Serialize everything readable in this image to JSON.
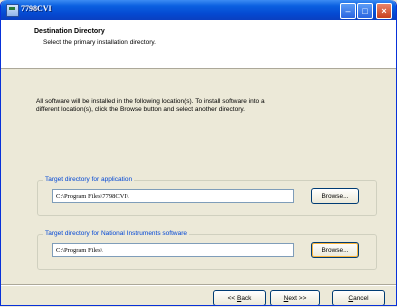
{
  "window": {
    "title": "7798CVI"
  },
  "header": {
    "title": "Destination Directory",
    "subtitle": "Select the primary installation directory."
  },
  "intro": {
    "line1": "All software will be installed in the following location(s). To install software into a",
    "line2": "different location(s), click the Browse button and select another directory."
  },
  "groups": {
    "app": {
      "label": "Target directory for application",
      "path": "C:\\Program Files\\7798CVI\\",
      "browse_label": "Browse..."
    },
    "ni": {
      "label": "Target directory for National Instruments software",
      "path": "C:\\Program Files\\",
      "browse_label": "Browse..."
    }
  },
  "buttons": {
    "back_prefix": "<< ",
    "back_accel": "B",
    "back_rest": "ack",
    "next_accel": "N",
    "next_rest": "ext >>",
    "cancel_accel": "C",
    "cancel_rest": "ancel"
  },
  "icons": {
    "window_icon": "installer-icon",
    "minimize": "minimize-icon",
    "maximize": "maximize-icon",
    "close": "close-icon"
  }
}
